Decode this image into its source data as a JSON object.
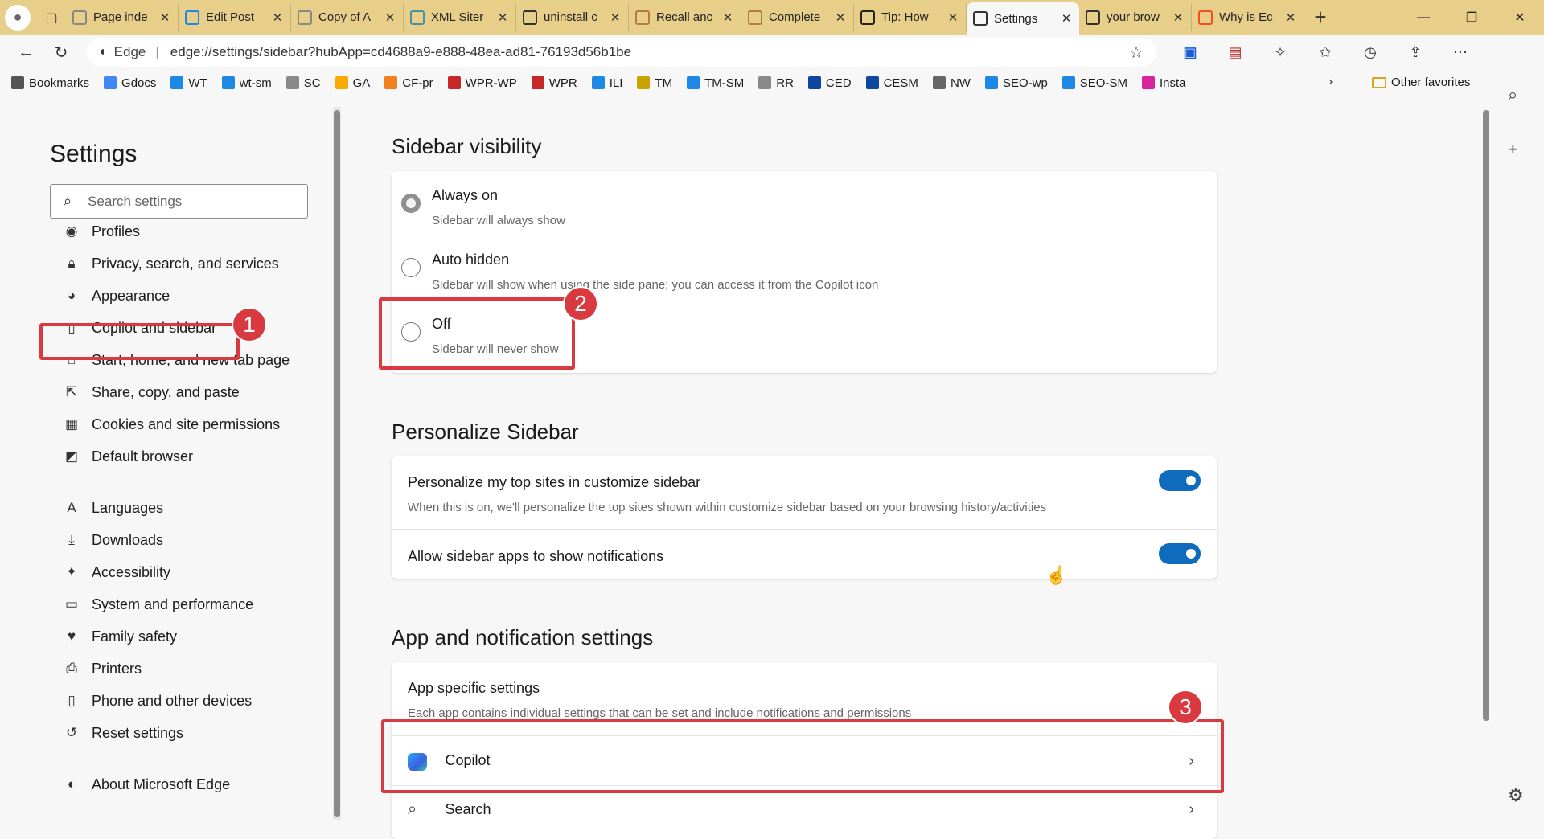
{
  "tabs": [
    {
      "label": "Page inde",
      "icon": "document-icon",
      "color": "#888888",
      "active": false
    },
    {
      "label": "Edit Post",
      "icon": "wt-logo-icon",
      "color": "#1e88e5",
      "active": false
    },
    {
      "label": "Copy of A",
      "icon": "google-docs-icon",
      "color": "#888888",
      "active": false
    },
    {
      "label": "XML Siter",
      "icon": "sitemap-icon",
      "color": "#4a90a4",
      "active": false
    },
    {
      "label": "uninstall c",
      "icon": "search-icon",
      "color": "#333333",
      "active": false
    },
    {
      "label": "Recall anc",
      "icon": "wt-thumbnail-icon",
      "color": "#b57a3f",
      "active": false
    },
    {
      "label": "Complete",
      "icon": "wt-thumbnail-icon",
      "color": "#b57a3f",
      "active": false
    },
    {
      "label": "Tip: How",
      "icon": "feather-icon",
      "color": "#222222",
      "active": false
    },
    {
      "label": "Settings",
      "icon": "gear-icon",
      "color": "#333333",
      "active": true
    },
    {
      "label": "your brow",
      "icon": "search-icon",
      "color": "#333333",
      "active": false
    },
    {
      "label": "Why is Ec",
      "icon": "microsoft-icon",
      "color": "#f25022",
      "active": false
    }
  ],
  "address": {
    "browser_label": "Edge",
    "url": "edge://settings/sidebar?hubApp=cd4688a9-e888-48ea-ad81-76193d56b1be"
  },
  "bookmarks": [
    {
      "label": "Bookmarks",
      "icon": "page-icon",
      "color": "#555555"
    },
    {
      "label": "Gdocs",
      "icon": "docs-icon",
      "color": "#4285f4"
    },
    {
      "label": "WT",
      "icon": "wt-logo-icon",
      "color": "#1e88e5"
    },
    {
      "label": "wt-sm",
      "icon": "wt-logo-icon",
      "color": "#1e88e5"
    },
    {
      "label": "SC",
      "icon": "console-icon",
      "color": "#888888"
    },
    {
      "label": "GA",
      "icon": "analytics-icon",
      "color": "#f9ab00"
    },
    {
      "label": "CF-pr",
      "icon": "cloud-icon",
      "color": "#f38020"
    },
    {
      "label": "WPR-WP",
      "icon": "wpr-icon",
      "color": "#c62828"
    },
    {
      "label": "WPR",
      "icon": "wpr-icon",
      "color": "#c62828"
    },
    {
      "label": "ILI",
      "icon": "heart-icon",
      "color": "#1e88e5"
    },
    {
      "label": "TM",
      "icon": "bulb-icon",
      "color": "#c9a400"
    },
    {
      "label": "TM-SM",
      "icon": "wt-logo-icon",
      "color": "#1e88e5"
    },
    {
      "label": "RR",
      "icon": "console-icon",
      "color": "#888888"
    },
    {
      "label": "CED",
      "icon": "ce-icon",
      "color": "#0d47a1"
    },
    {
      "label": "CESM",
      "icon": "ce-icon",
      "color": "#0d47a1"
    },
    {
      "label": "NW",
      "icon": "feather-icon",
      "color": "#666666"
    },
    {
      "label": "SEO-wp",
      "icon": "wt-logo-icon",
      "color": "#1e88e5"
    },
    {
      "label": "SEO-SM",
      "icon": "wt-logo-icon",
      "color": "#1e88e5"
    },
    {
      "label": "Insta",
      "icon": "instagram-icon",
      "color": "#d6249f"
    }
  ],
  "other_favorites": "Other favorites",
  "sidebar": {
    "title": "Settings",
    "search_placeholder": "Search settings",
    "items": [
      {
        "label": "Profiles",
        "icon": "profile-icon"
      },
      {
        "label": "Privacy, search, and services",
        "icon": "lock-icon"
      },
      {
        "label": "Appearance",
        "icon": "palette-icon"
      },
      {
        "label": "Copilot and sidebar",
        "icon": "sidebar-icon"
      },
      {
        "label": "Start, home, and new tab page",
        "icon": "home-icon"
      },
      {
        "label": "Share, copy, and paste",
        "icon": "share-icon"
      },
      {
        "label": "Cookies and site permissions",
        "icon": "cookies-icon"
      },
      {
        "label": "Default browser",
        "icon": "browser-icon"
      },
      {
        "label": "Languages",
        "icon": "languages-icon"
      },
      {
        "label": "Downloads",
        "icon": "download-icon"
      },
      {
        "label": "Accessibility",
        "icon": "accessibility-icon"
      },
      {
        "label": "System and performance",
        "icon": "laptop-icon"
      },
      {
        "label": "Family safety",
        "icon": "family-icon"
      },
      {
        "label": "Printers",
        "icon": "printer-icon"
      },
      {
        "label": "Phone and other devices",
        "icon": "phone-icon"
      },
      {
        "label": "Reset settings",
        "icon": "reset-icon"
      },
      {
        "label": "About Microsoft Edge",
        "icon": "edge-logo-icon"
      }
    ]
  },
  "visibility": {
    "title": "Sidebar visibility",
    "options": [
      {
        "label": "Always on",
        "desc": "Sidebar will always show",
        "checked": true
      },
      {
        "label": "Auto hidden",
        "desc": "Sidebar will show when using the side pane; you can access it from the Copilot icon",
        "checked": false
      },
      {
        "label": "Off",
        "desc": "Sidebar will never show",
        "checked": false
      }
    ]
  },
  "personalize": {
    "title": "Personalize Sidebar",
    "rows": [
      {
        "label": "Personalize my top sites in customize sidebar",
        "desc": "When this is on, we'll personalize the top sites shown within customize sidebar based on your browsing history/activities",
        "on": true
      },
      {
        "label": "Allow sidebar apps to show notifications",
        "desc": "",
        "on": true
      }
    ]
  },
  "apps": {
    "title": "App and notification settings",
    "specific_title": "App specific settings",
    "specific_desc": "Each app contains individual settings that can be set and include notifications and permissions",
    "items": [
      {
        "label": "Copilot",
        "icon": "copilot-icon"
      },
      {
        "label": "Search",
        "icon": "search-icon"
      }
    ]
  },
  "callouts": [
    "1",
    "2",
    "3"
  ]
}
